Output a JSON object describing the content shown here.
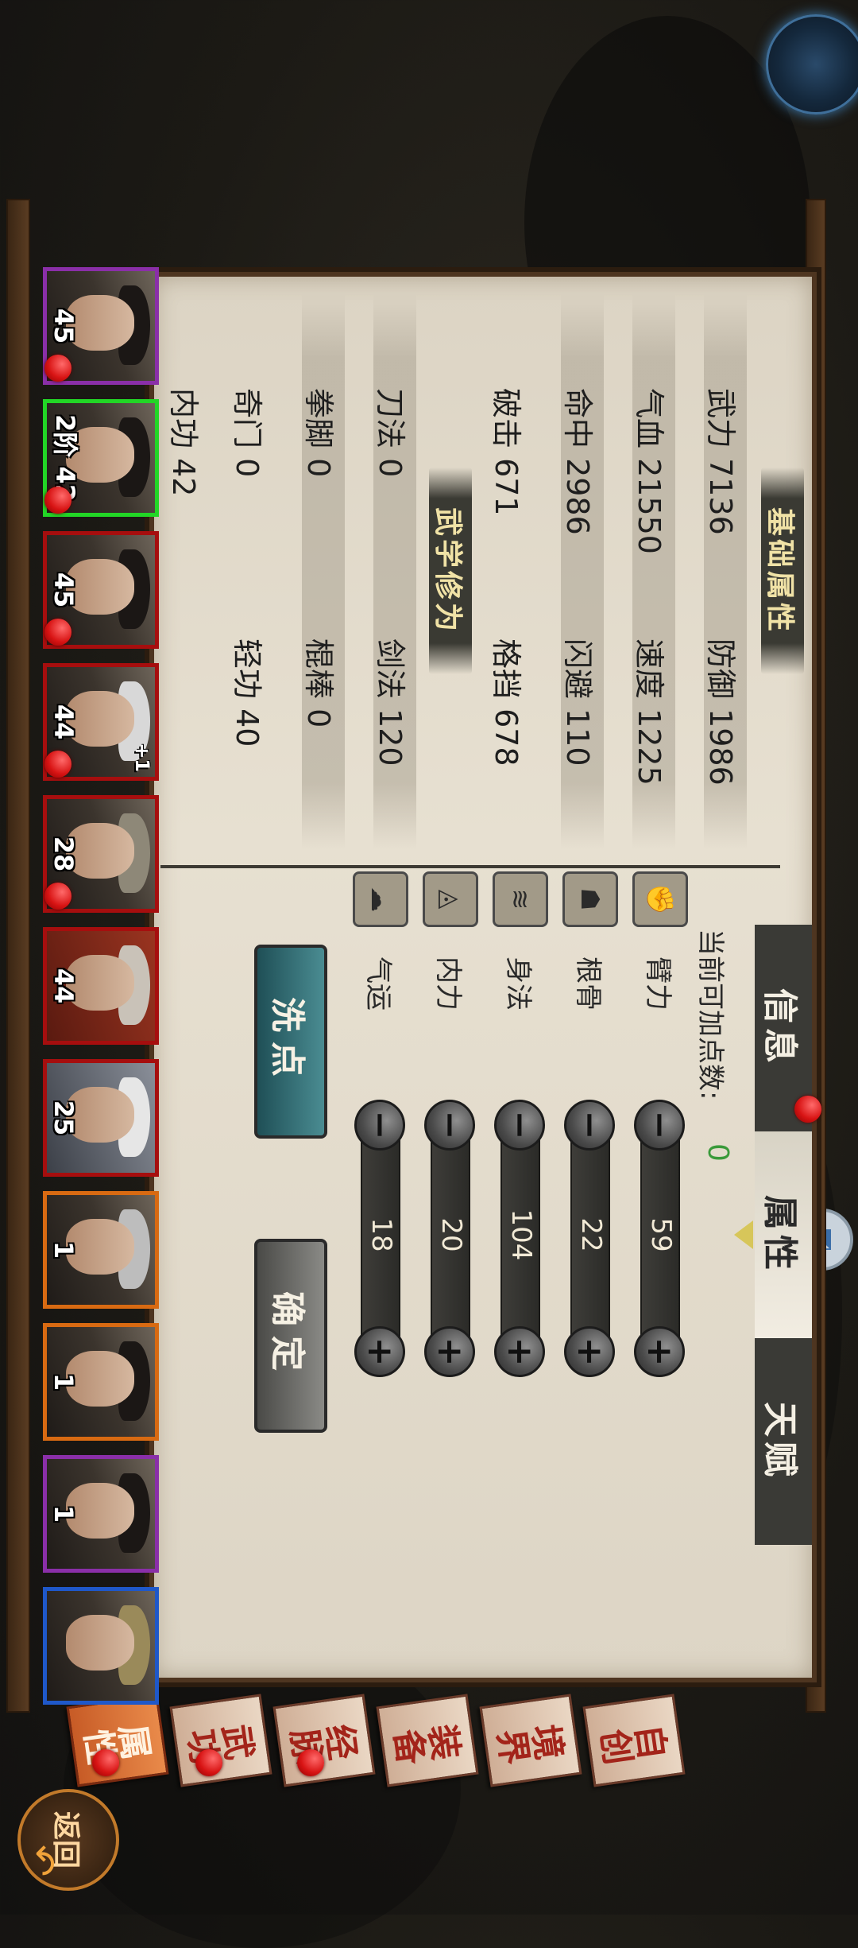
{
  "tabs": [
    {
      "label": "信息",
      "active": false,
      "dot": true
    },
    {
      "label": "属性",
      "active": true,
      "dot": false
    },
    {
      "label": "天赋",
      "active": false,
      "dot": false
    }
  ],
  "points": {
    "available_label": "当前可加点数:",
    "available_value": "0",
    "rows": [
      {
        "label": "臂力",
        "icon": "arm-icon",
        "value": "59"
      },
      {
        "label": "根骨",
        "icon": "bone-icon",
        "value": "22"
      },
      {
        "label": "身法",
        "icon": "movement-icon",
        "value": "104"
      },
      {
        "label": "内力",
        "icon": "inner-power-icon",
        "value": "20"
      },
      {
        "label": "气运",
        "icon": "luck-icon",
        "value": "18"
      }
    ],
    "reset_label": "洗点",
    "confirm_label": "确定"
  },
  "basic": {
    "title": "基础属性",
    "stats": [
      {
        "text": "武力 7136"
      },
      {
        "text": "防御 1986"
      },
      {
        "text": "气血 21550"
      },
      {
        "text": "速度 1225"
      },
      {
        "text": "命中 2986"
      },
      {
        "text": "闪避 110"
      },
      {
        "text": "破击 671"
      },
      {
        "text": "格挡 678"
      }
    ]
  },
  "martial": {
    "title": "武学修为",
    "stats": [
      {
        "text": "刀法 0"
      },
      {
        "text": "剑法 120"
      },
      {
        "text": "拳脚 0"
      },
      {
        "text": "棍棒 0"
      },
      {
        "text": "奇门 0"
      },
      {
        "text": "轻功 40"
      },
      {
        "text": "内功 42"
      }
    ]
  },
  "menu": [
    {
      "label": "属性",
      "active": true,
      "dot": true
    },
    {
      "label": "武功",
      "active": false,
      "dot": true
    },
    {
      "label": "经脉",
      "active": false,
      "dot": true
    },
    {
      "label": "装备",
      "active": false,
      "dot": false
    },
    {
      "label": "境界",
      "active": false,
      "dot": false
    },
    {
      "label": "自创",
      "active": false,
      "dot": false
    }
  ],
  "back_label": "返回",
  "characters": [
    {
      "level": "45",
      "border": "#8a2fa8",
      "dot": true,
      "plus": ""
    },
    {
      "level": "2阶 42",
      "border": "#22d626",
      "dot": true,
      "plus": ""
    },
    {
      "level": "45",
      "border": "#b21818",
      "dot": true,
      "plus": ""
    },
    {
      "level": "44",
      "border": "#b21818",
      "dot": true,
      "plus": "+1"
    },
    {
      "level": "28",
      "border": "#b21818",
      "dot": true,
      "plus": ""
    },
    {
      "level": "44",
      "border": "#b21818",
      "dot": false,
      "plus": ""
    },
    {
      "level": "25",
      "border": "#b21818",
      "dot": false,
      "plus": ""
    },
    {
      "level": "1",
      "border": "#d86a12",
      "dot": false,
      "plus": ""
    },
    {
      "level": "1",
      "border": "#d86a12",
      "dot": false,
      "plus": ""
    },
    {
      "level": "1",
      "border": "#8a2fa8",
      "dot": false,
      "plus": ""
    },
    {
      "level": "",
      "border": "#1f58c9",
      "dot": false,
      "plus": ""
    }
  ]
}
